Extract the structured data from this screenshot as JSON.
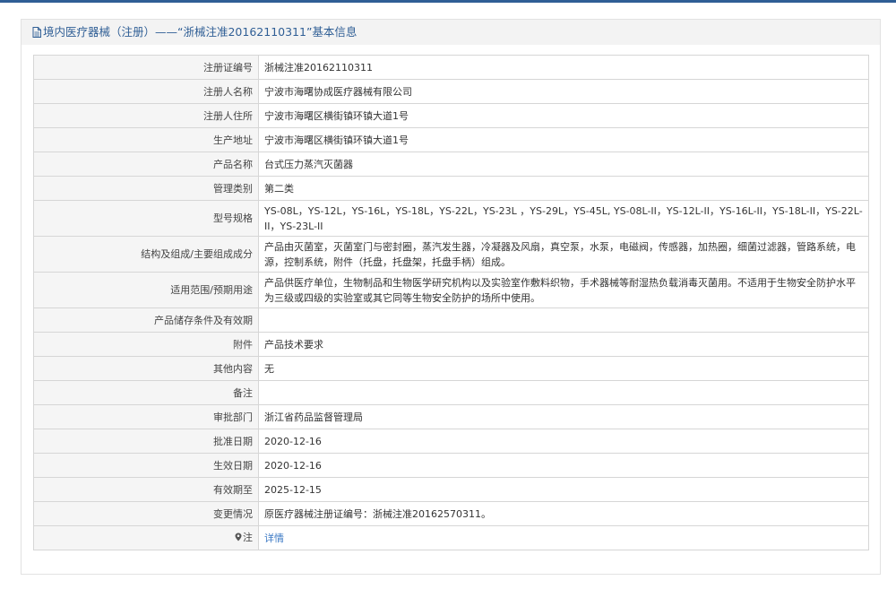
{
  "header": {
    "title": "境内医疗器械（注册）——“浙械注准20162110311”基本信息",
    "icon": "document-icon"
  },
  "rows": [
    {
      "label": "注册证编号",
      "value": "浙械注准20162110311"
    },
    {
      "label": "注册人名称",
      "value": "宁波市海曙协成医疗器械有限公司"
    },
    {
      "label": "注册人住所",
      "value": "宁波市海曙区横街镇环镇大道1号"
    },
    {
      "label": "生产地址",
      "value": "宁波市海曙区横街镇环镇大道1号"
    },
    {
      "label": "产品名称",
      "value": "台式压力蒸汽灭菌器"
    },
    {
      "label": "管理类别",
      "value": "第二类"
    },
    {
      "label": "型号规格",
      "value": "YS-08L，YS-12L，YS-16L，YS-18L，YS-22L，YS-23L ，YS-29L，YS-45L, YS-08L-II，YS-12L-II，YS-16L-II，YS-18L-II，YS-22L-II，YS-23L-II"
    },
    {
      "label": "结构及组成/主要组成成分",
      "value": "产品由灭菌室，灭菌室门与密封圈，蒸汽发生器，冷凝器及风扇，真空泵，水泵，电磁阀，传感器，加热圈，细菌过滤器，管路系统，电源，控制系统，附件（托盘，托盘架，托盘手柄）组成。"
    },
    {
      "label": "适用范围/预期用途",
      "value": "产品供医疗单位，生物制品和生物医学研究机构以及实验室作敷料织物，手术器械等耐湿热负载消毒灭菌用。不适用于生物安全防护水平为三级或四级的实验室或其它同等生物安全防护的场所中使用。"
    },
    {
      "label": "产品储存条件及有效期",
      "value": ""
    },
    {
      "label": "附件",
      "value": "产品技术要求"
    },
    {
      "label": "其他内容",
      "value": "无"
    },
    {
      "label": "备注",
      "value": ""
    },
    {
      "label": "审批部门",
      "value": "浙江省药品监督管理局"
    },
    {
      "label": "批准日期",
      "value": "2020-12-16"
    },
    {
      "label": "生效日期",
      "value": "2020-12-16"
    },
    {
      "label": "有效期至",
      "value": "2025-12-15"
    },
    {
      "label": "变更情况",
      "value": "原医疗器械注册证编号：浙械注准20162570311。"
    }
  ],
  "note_row": {
    "label": "注",
    "link_text": "详情",
    "icon": "location-pin-icon"
  },
  "colors": {
    "header_text": "#2f5e95",
    "link": "#3a78c4",
    "top_rule": "#2f5e95"
  }
}
